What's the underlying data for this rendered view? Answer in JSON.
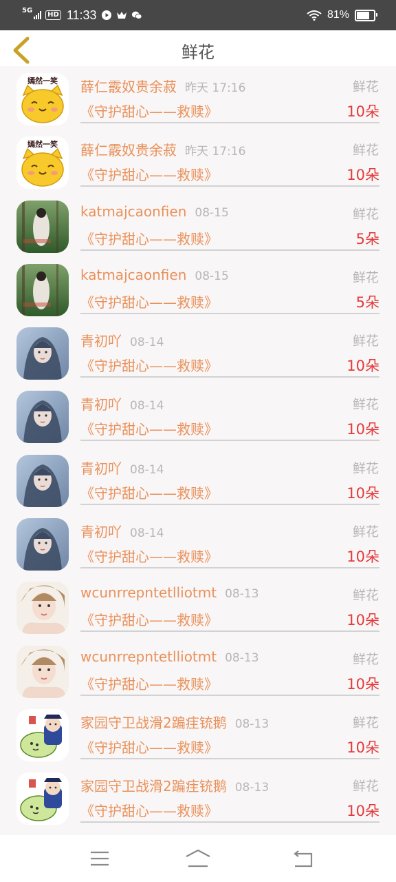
{
  "status_bar": {
    "network": "5G",
    "hd": "HD",
    "time": "11:33",
    "battery_percent": "81%",
    "battery_level": 0.81
  },
  "header": {
    "title": "鲜花"
  },
  "items": [
    {
      "name": "薛仁霰奴贵余菽",
      "time": "昨天 17:16",
      "type": "鲜花",
      "book": "《守护甜心——救赎》",
      "quantity": "10朵",
      "avatar": "cat-avatar",
      "avatar_caption": "嫣然一笑"
    },
    {
      "name": "薛仁霰奴贵余菽",
      "time": "昨天 17:16",
      "type": "鲜花",
      "book": "《守护甜心——救赎》",
      "quantity": "10朵",
      "avatar": "cat-avatar",
      "avatar_caption": "嫣然一笑"
    },
    {
      "name": "katmajcaonfien",
      "time": "08-15",
      "type": "鲜花",
      "book": "《守护甜心——救赎》",
      "quantity": "5朵",
      "avatar": "forest-girl-avatar"
    },
    {
      "name": "katmajcaonfien",
      "time": "08-15",
      "type": "鲜花",
      "book": "《守护甜心——救赎》",
      "quantity": "5朵",
      "avatar": "forest-girl-avatar"
    },
    {
      "name": "青初吖",
      "time": "08-14",
      "type": "鲜花",
      "book": "《守护甜心——救赎》",
      "quantity": "10朵",
      "avatar": "blue-girl-avatar"
    },
    {
      "name": "青初吖",
      "time": "08-14",
      "type": "鲜花",
      "book": "《守护甜心——救赎》",
      "quantity": "10朵",
      "avatar": "blue-girl-avatar"
    },
    {
      "name": "青初吖",
      "time": "08-14",
      "type": "鲜花",
      "book": "《守护甜心——救赎》",
      "quantity": "10朵",
      "avatar": "blue-girl-avatar"
    },
    {
      "name": "青初吖",
      "time": "08-14",
      "type": "鲜花",
      "book": "《守护甜心——救赎》",
      "quantity": "10朵",
      "avatar": "blue-girl-avatar"
    },
    {
      "name": "wcunrrepntetlliotmt",
      "time": "08-13",
      "type": "鲜花",
      "book": "《守护甜心——救赎》",
      "quantity": "10朵",
      "avatar": "portrait-avatar"
    },
    {
      "name": "wcunrrepntetlliotmt",
      "time": "08-13",
      "type": "鲜花",
      "book": "《守护甜心——救赎》",
      "quantity": "10朵",
      "avatar": "portrait-avatar"
    },
    {
      "name": "家园守卫战滑2蹁疰铳鹅",
      "time": "08-13",
      "type": "鲜花",
      "book": "《守护甜心——救赎》",
      "quantity": "10朵",
      "avatar": "cartoon-avatar"
    },
    {
      "name": "家园守卫战滑2蹁疰铳鹅",
      "time": "08-13",
      "type": "鲜花",
      "book": "《守护甜心——救赎》",
      "quantity": "10朵",
      "avatar": "cartoon-avatar"
    }
  ],
  "nav": {
    "menu_icon": "menu-icon",
    "home_icon": "home-icon",
    "back_icon": "back-arrow-icon"
  },
  "colors": {
    "name_orange": "#e9915a",
    "quantity_red": "#e33b3b",
    "muted_gray": "#b7b7b7",
    "back_chevron": "#c8a227"
  }
}
